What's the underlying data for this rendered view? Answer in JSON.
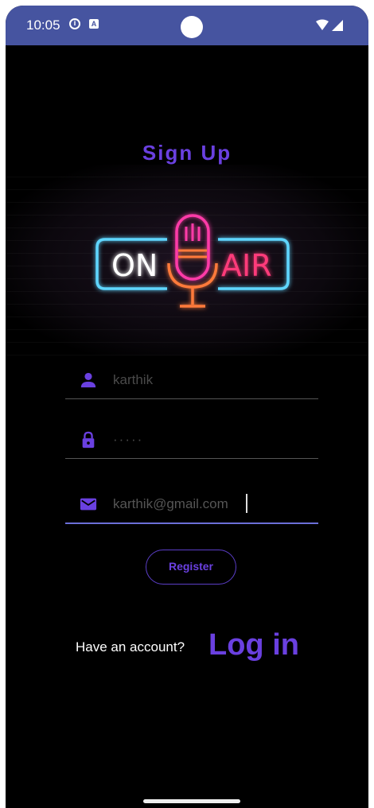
{
  "status_bar": {
    "time": "10:05",
    "icons": [
      "info-icon",
      "a-notification-icon",
      "camera-cutout",
      "wifi-icon",
      "cellular-signal-icon"
    ]
  },
  "page": {
    "title": "Sign Up"
  },
  "logo": {
    "text_left": "ON",
    "text_right": "AIR",
    "icon": "microphone-neon-icon",
    "colors": {
      "frame": "#5fd6ff",
      "mic": "#ff3aa8",
      "stand": "#ff7a3a"
    }
  },
  "form": {
    "username": {
      "icon": "person-icon",
      "value": "karthik"
    },
    "password": {
      "icon": "lock-icon",
      "value": "·····"
    },
    "email": {
      "icon": "mail-icon",
      "value": "karthik@gmail.com"
    }
  },
  "buttons": {
    "register": "Register"
  },
  "footer": {
    "prompt": "Have an account?",
    "login_link": "Log in"
  },
  "colors": {
    "accent": "#6a40e0",
    "status_bar": "#4654a0",
    "background": "#000000"
  }
}
